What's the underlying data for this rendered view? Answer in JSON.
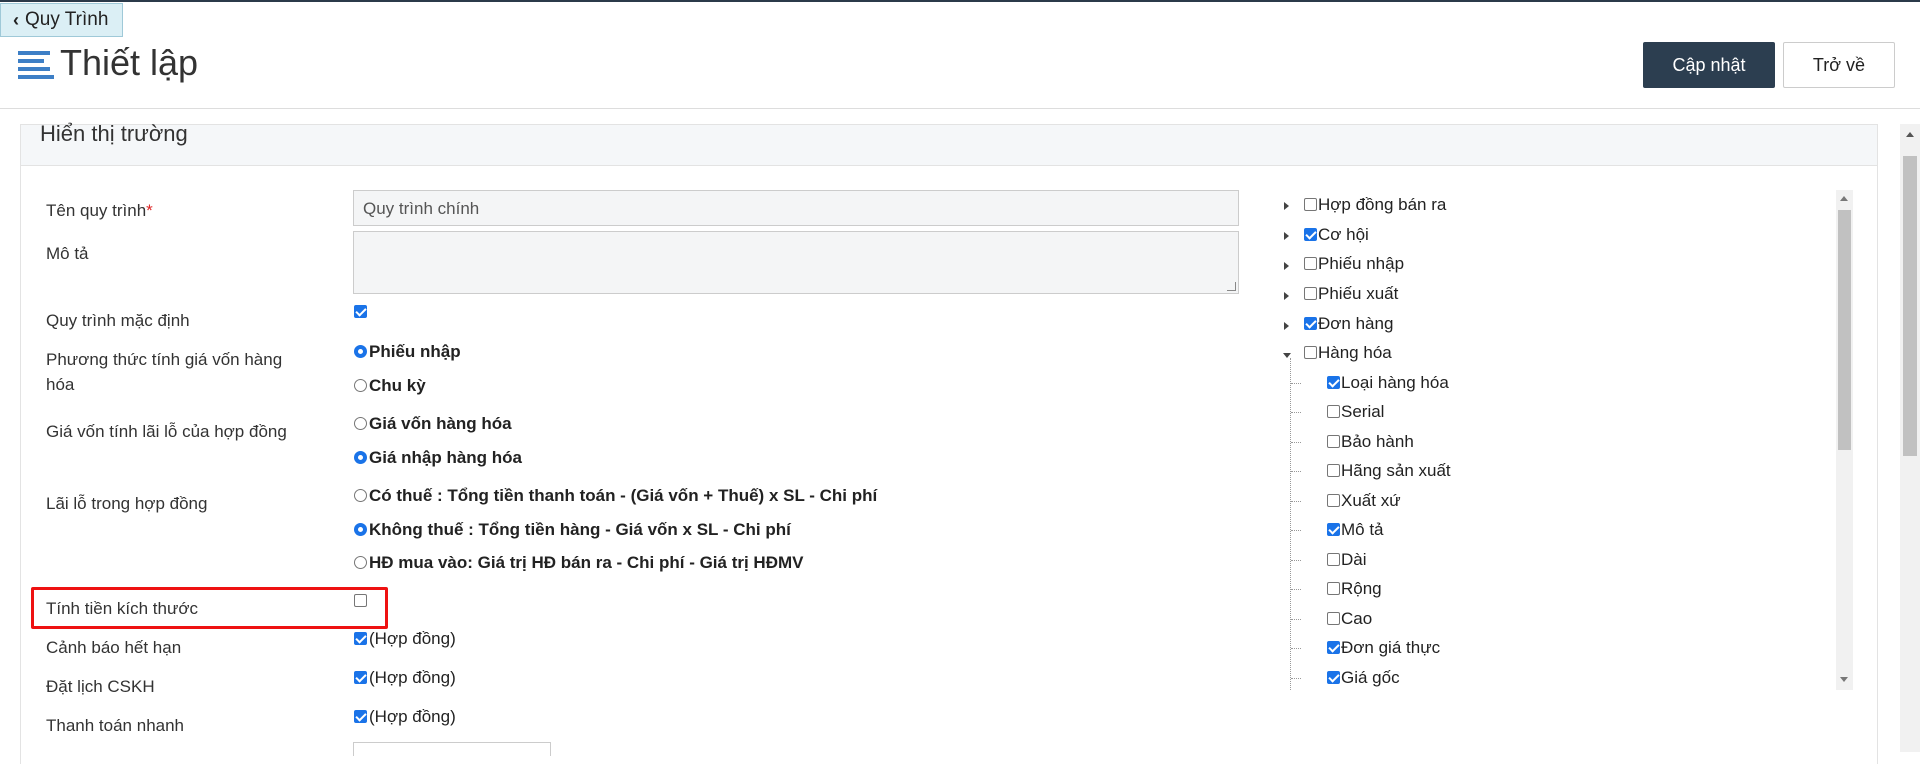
{
  "nav": {
    "back_label": "Quy Trình"
  },
  "header": {
    "title": "Thiết lập",
    "update_label": "Cập nhật",
    "return_label": "Trở về"
  },
  "panel": {
    "title": "Hiển thị trường"
  },
  "form": {
    "process_name_label": "Tên quy trình",
    "required_mark": "*",
    "process_name_value": "Quy trình chính",
    "description_label": "Mô tả",
    "description_value": "",
    "default_process_label": "Quy trình mặc định",
    "default_process_checked": true,
    "cost_method_label": "Phương thức tính giá vốn hàng hóa",
    "cost_method_options": [
      {
        "label": "Phiếu nhập",
        "selected": true
      },
      {
        "label": "Chu kỳ",
        "selected": false
      }
    ],
    "profit_cost_label": "Giá vốn tính lãi lỗ của hợp đồng",
    "profit_cost_options": [
      {
        "label": "Giá vốn hàng hóa",
        "selected": false
      },
      {
        "label": "Giá nhập hàng hóa",
        "selected": true
      }
    ],
    "contract_profit_label": "Lãi lỗ trong hợp đồng",
    "contract_profit_options": [
      {
        "label": "Có thuế : Tổng tiền thanh toán - (Giá vốn + Thuế) x SL - Chi phí",
        "selected": false
      },
      {
        "label": "Không thuế : Tổng tiền hàng - Giá vốn x SL - Chi phí",
        "selected": true
      },
      {
        "label": "HĐ mua vào: Giá trị HĐ bán ra - Chi phí - Giá trị HĐMV",
        "selected": false
      }
    ],
    "size_pricing_label": "Tính tiền kích thước",
    "size_pricing_checked": false,
    "expiry_warning_label": "Cảnh báo hết hạn",
    "expiry_warning_text": "(Hợp đồng)",
    "expiry_warning_checked": true,
    "schedule_cs_label": "Đặt lịch CSKH",
    "schedule_cs_text": "(Hợp đồng)",
    "schedule_cs_checked": true,
    "quick_pay_label": "Thanh toán nhanh",
    "quick_pay_text": "(Hợp đồng)",
    "quick_pay_checked": true
  },
  "tree": {
    "nodes": [
      {
        "label": "Hợp đồng bán ra",
        "checked": false,
        "expander": "collapsed"
      },
      {
        "label": "Cơ hội",
        "checked": true,
        "expander": "collapsed"
      },
      {
        "label": "Phiếu nhập",
        "checked": false,
        "expander": "collapsed"
      },
      {
        "label": "Phiếu xuất",
        "checked": false,
        "expander": "collapsed"
      },
      {
        "label": "Đơn hàng",
        "checked": true,
        "expander": "collapsed"
      },
      {
        "label": "Hàng hóa",
        "checked": false,
        "expander": "expanded"
      }
    ],
    "children": [
      {
        "label": "Loại hàng hóa",
        "checked": true
      },
      {
        "label": "Serial",
        "checked": false
      },
      {
        "label": "Bảo hành",
        "checked": false
      },
      {
        "label": "Hãng sản xuất",
        "checked": false
      },
      {
        "label": "Xuất xứ",
        "checked": false
      },
      {
        "label": "Mô tả",
        "checked": true
      },
      {
        "label": "Dài",
        "checked": false
      },
      {
        "label": "Rộng",
        "checked": false
      },
      {
        "label": "Cao",
        "checked": false
      },
      {
        "label": "Đơn giá thực",
        "checked": true
      },
      {
        "label": "Giá gốc",
        "checked": true
      }
    ]
  }
}
